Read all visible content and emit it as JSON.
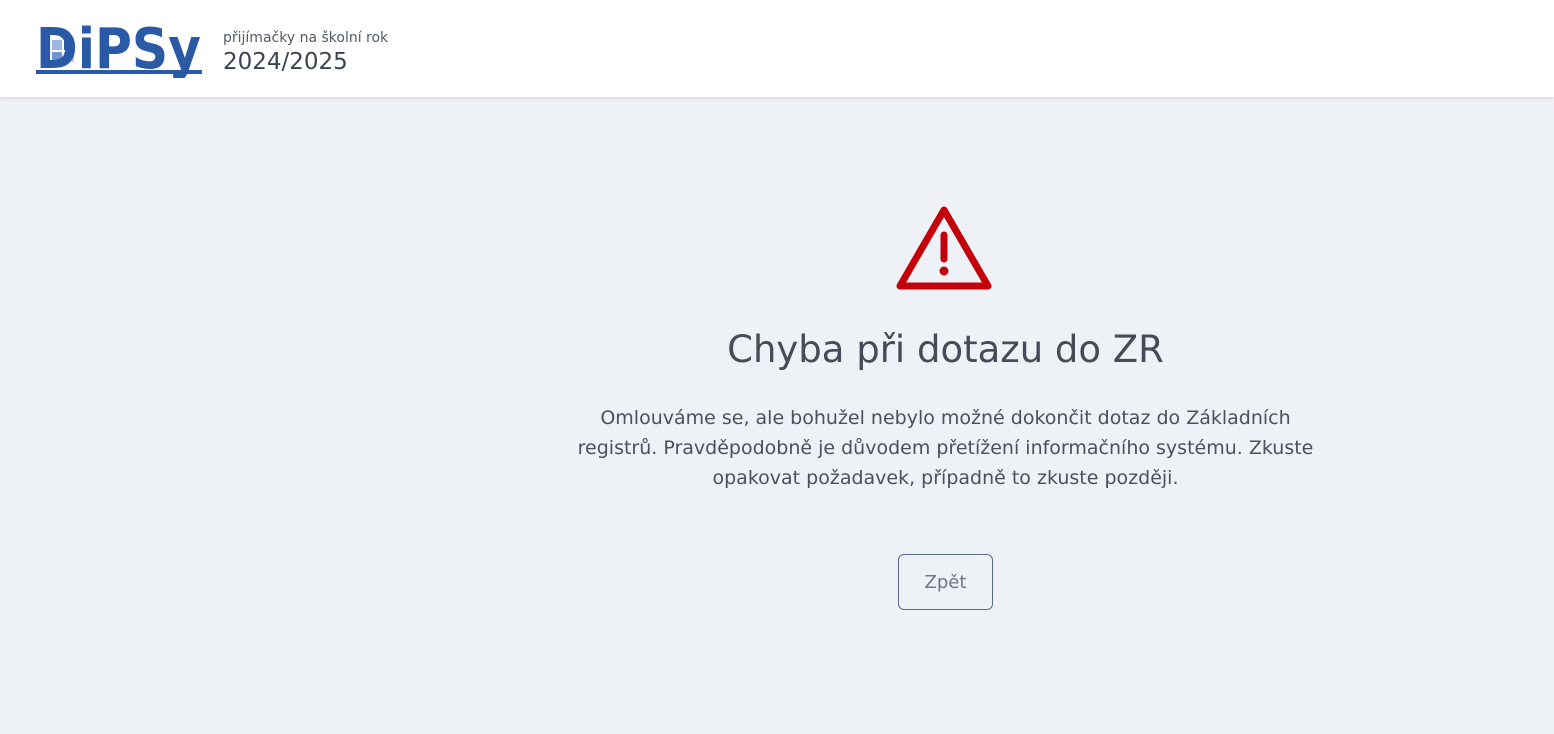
{
  "header": {
    "logo_text": "DiPSy",
    "year_caption": "přijímačky na školní rok",
    "year_value": "2024/2025"
  },
  "error": {
    "icon": "warning-triangle-icon",
    "title": "Chyba při dotazu do ZR",
    "message": "Omlouváme se, ale bohužel nebylo možné dokončit dotaz do Základních registrů. Pravděpodobně je důvodem přetížení informačního systému. Zkuste opakovat požadavek, případně to zkuste později.",
    "back_label": "Zpět"
  },
  "colors": {
    "brand": "#2a5aa6",
    "warning": "#c4000b",
    "background": "#eef1f6"
  }
}
